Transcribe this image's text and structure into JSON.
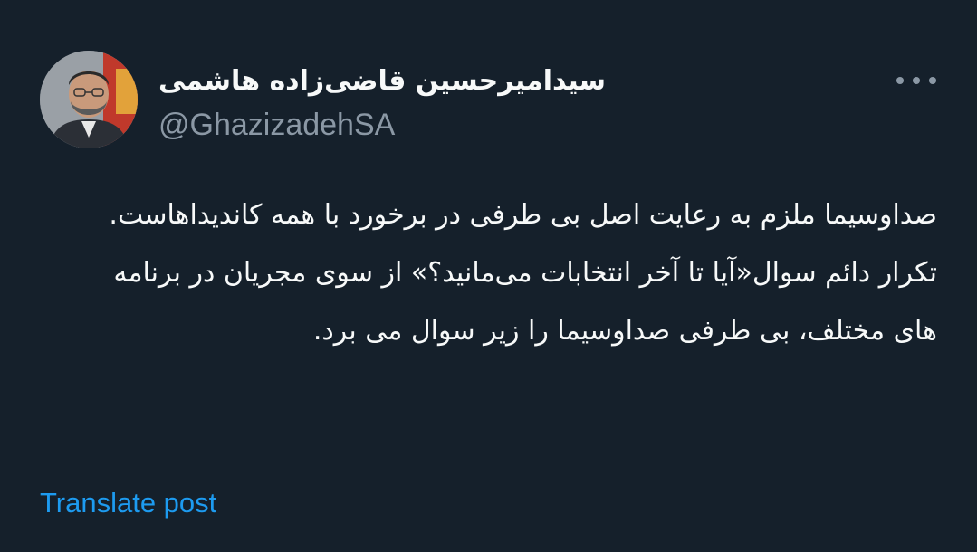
{
  "author": {
    "display_name": "سیدامیرحسین قاضی‌زاده هاشمی",
    "handle": "@GhazizadehSA",
    "avatar_icon": "profile-photo"
  },
  "menu": {
    "more_icon": "more-horizontal-icon"
  },
  "post": {
    "paragraph_1": "صداوسیما ملزم به رعایت اصل بی طرفی در برخورد با همه کاندیداهاست.",
    "paragraph_2": "تکرار دائم سوال«آیا تا آخر انتخابات می‌مانید؟» از سوی مجریان در برنامه های مختلف، بی طرفی صداوسیما را زیر سوال می برد."
  },
  "actions": {
    "translate_label": "Translate post"
  },
  "colors": {
    "background": "#15202b",
    "text_primary": "#f7f9f9",
    "text_secondary": "#8b98a5",
    "link": "#1d9bf0"
  }
}
